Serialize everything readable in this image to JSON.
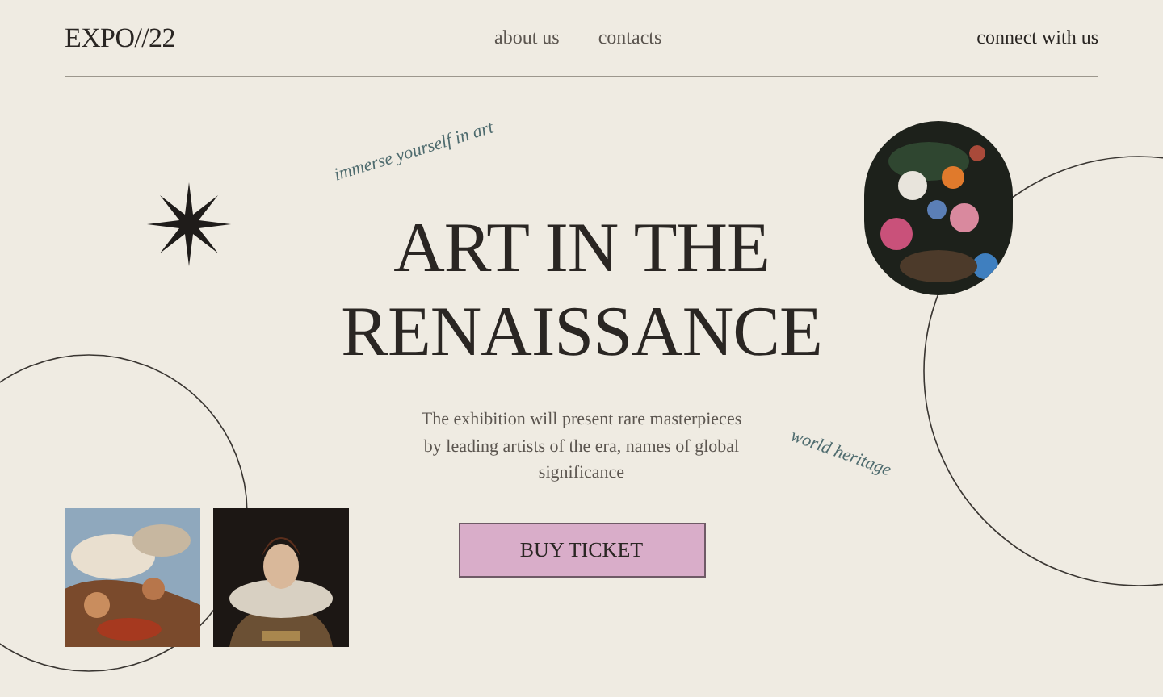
{
  "header": {
    "logo": "EXPO//22",
    "nav": [
      {
        "label": "about us"
      },
      {
        "label": "contacts"
      }
    ],
    "connect": "connect with us"
  },
  "hero": {
    "tagline": "immerse yourself in art",
    "title_lines": [
      "ART IN THE",
      "RENAISSANCE"
    ],
    "description": "The exhibition will present rare masterpieces by leading artists of the era, names of global significance",
    "side_note": "world heritage",
    "button": "BUY TICKET"
  }
}
